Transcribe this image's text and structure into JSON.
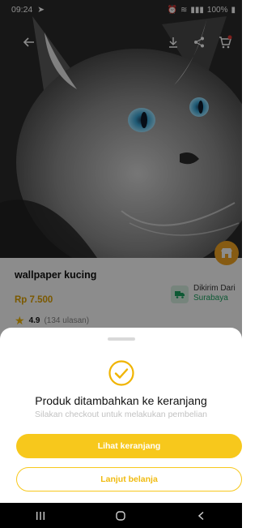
{
  "status_bar": {
    "time": "09:24",
    "battery_text": "100%"
  },
  "product": {
    "title": "wallpaper kucing",
    "price": "Rp 7.500",
    "rating": "4.9",
    "reviews": "(134 ulasan)",
    "shipping_label": "Dikirim Dari",
    "shipping_city": "Surabaya"
  },
  "sheet": {
    "title": "Produk ditambahkan ke keranjang",
    "subtitle": "Silakan checkout untuk melakukan pembelian",
    "primary_button": "Lihat keranjang",
    "secondary_button": "Lanjut belanja"
  },
  "colors": {
    "accent": "#f7c81c",
    "price": "#e1a200",
    "success": "#f0b400",
    "shipping": "#1aa260"
  },
  "icons": {
    "back": "arrow-left-icon",
    "download": "download-icon",
    "share": "share-icon",
    "cart": "cart-icon",
    "success": "check-circle-icon",
    "shipping": "truck-icon",
    "star": "star-icon"
  }
}
